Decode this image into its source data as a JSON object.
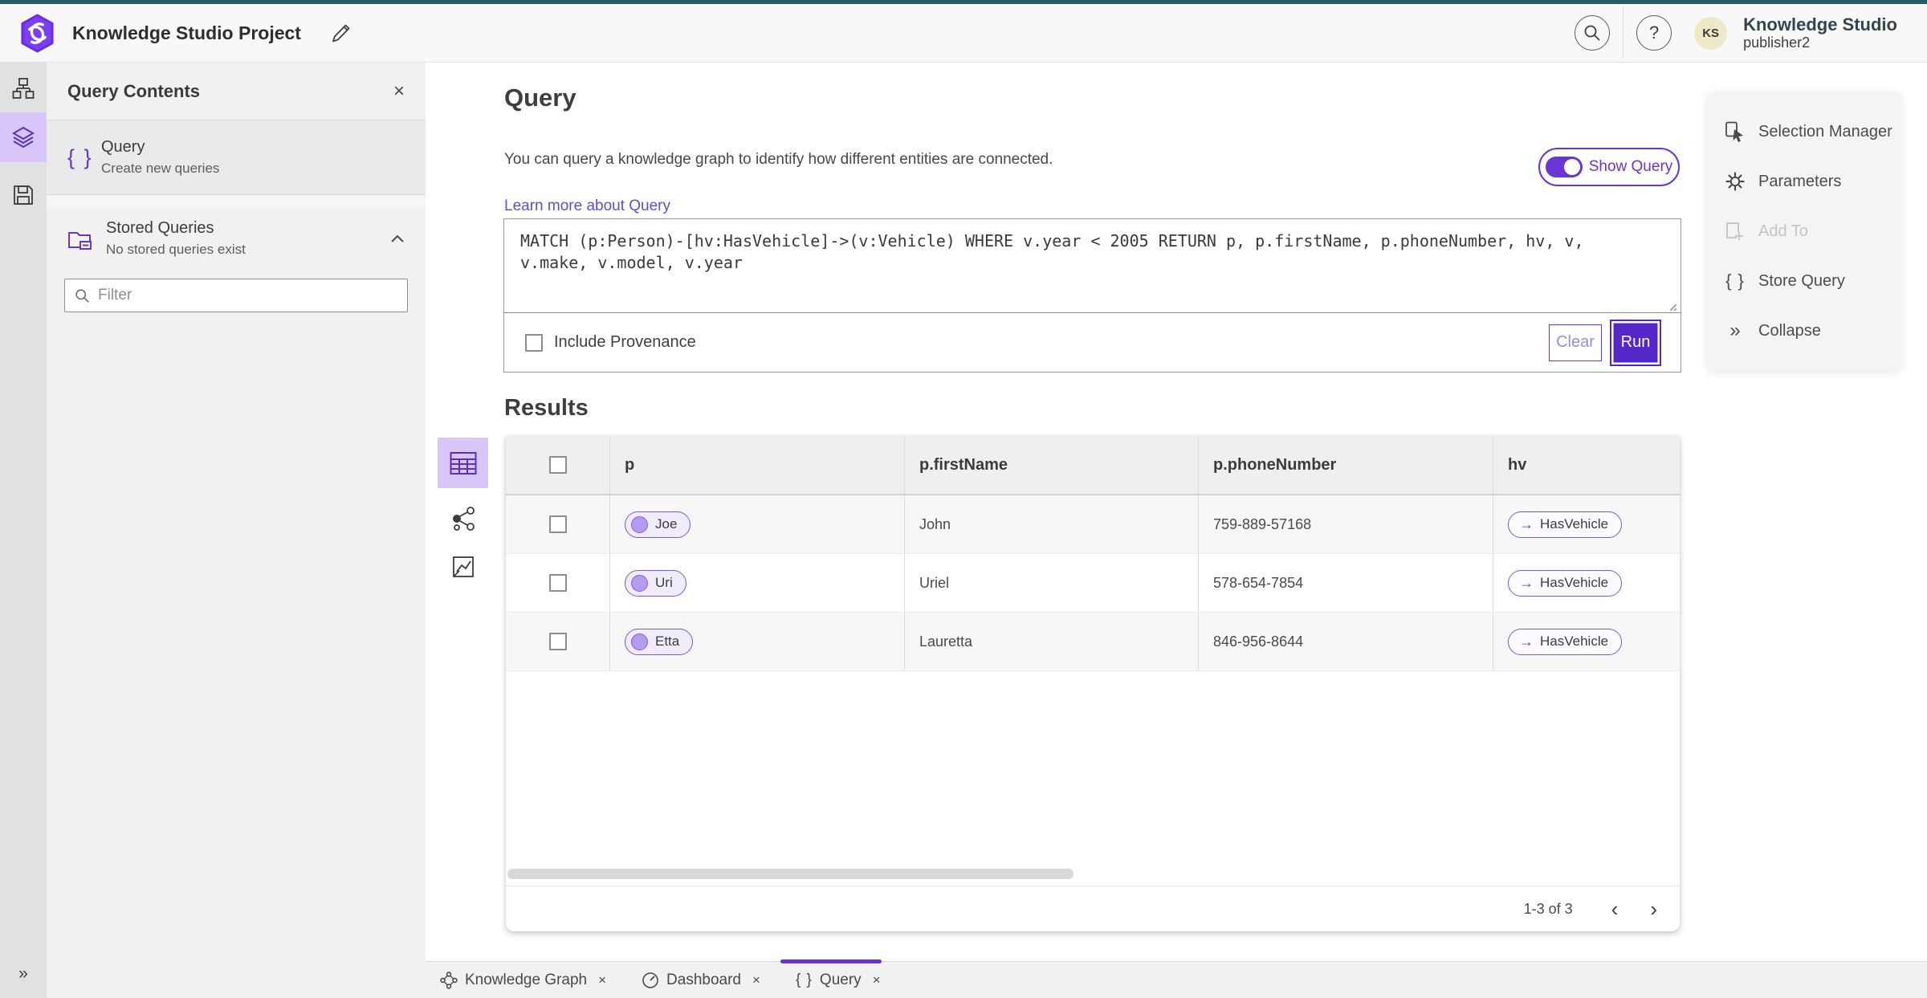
{
  "header": {
    "app_title": "Knowledge Studio Project",
    "product_name": "Knowledge Studio",
    "user_role": "publisher2",
    "avatar_initials": "KS"
  },
  "panel": {
    "title": "Query Contents",
    "query_item": {
      "title": "Query",
      "subtitle": "Create new queries"
    },
    "stored": {
      "title": "Stored Queries",
      "subtitle": "No stored queries exist"
    },
    "filter_placeholder": "Filter"
  },
  "query": {
    "heading": "Query",
    "description": "You can query a knowledge graph to identify how different entities are connected.",
    "link": "Learn more about Query",
    "toggle_label": "Show Query",
    "text": "MATCH (p:Person)-[hv:HasVehicle]->(v:Vehicle) WHERE v.year < 2005 RETURN p, p.firstName, p.phoneNumber, hv, v,\nv.make, v.model, v.year",
    "include_label": "Include Provenance",
    "clear_label": "Clear",
    "run_label": "Run"
  },
  "results": {
    "heading": "Results",
    "columns": [
      "p",
      "p.firstName",
      "p.phoneNumber",
      "hv"
    ],
    "rows": [
      {
        "entity": "Joe",
        "firstName": "John",
        "phone": "759-889-57168",
        "relation": "HasVehicle"
      },
      {
        "entity": "Uri",
        "firstName": "Uriel",
        "phone": "578-654-7854",
        "relation": "HasVehicle"
      },
      {
        "entity": "Etta",
        "firstName": "Lauretta",
        "phone": "846-956-8644",
        "relation": "HasVehicle"
      }
    ],
    "pagination": "1-3 of 3"
  },
  "menu": {
    "items": [
      {
        "label": "Selection Manager"
      },
      {
        "label": "Parameters"
      },
      {
        "label": "Add To",
        "disabled": true
      },
      {
        "label": "Store Query"
      },
      {
        "label": "Collapse"
      }
    ]
  },
  "tabs": [
    {
      "label": "Knowledge Graph"
    },
    {
      "label": "Dashboard"
    },
    {
      "label": "Query",
      "active": true
    }
  ],
  "icons": {
    "close": "×",
    "braces": "{ }",
    "collapse": "»",
    "expand": "»",
    "prev": "‹",
    "next": "›",
    "arrow_right": "→",
    "help": "?"
  },
  "colors": {
    "accent": "#6935d3",
    "run_button": "#5527c9",
    "selected_bg": "#d8c6f8",
    "top_strip": "#265a5d"
  }
}
